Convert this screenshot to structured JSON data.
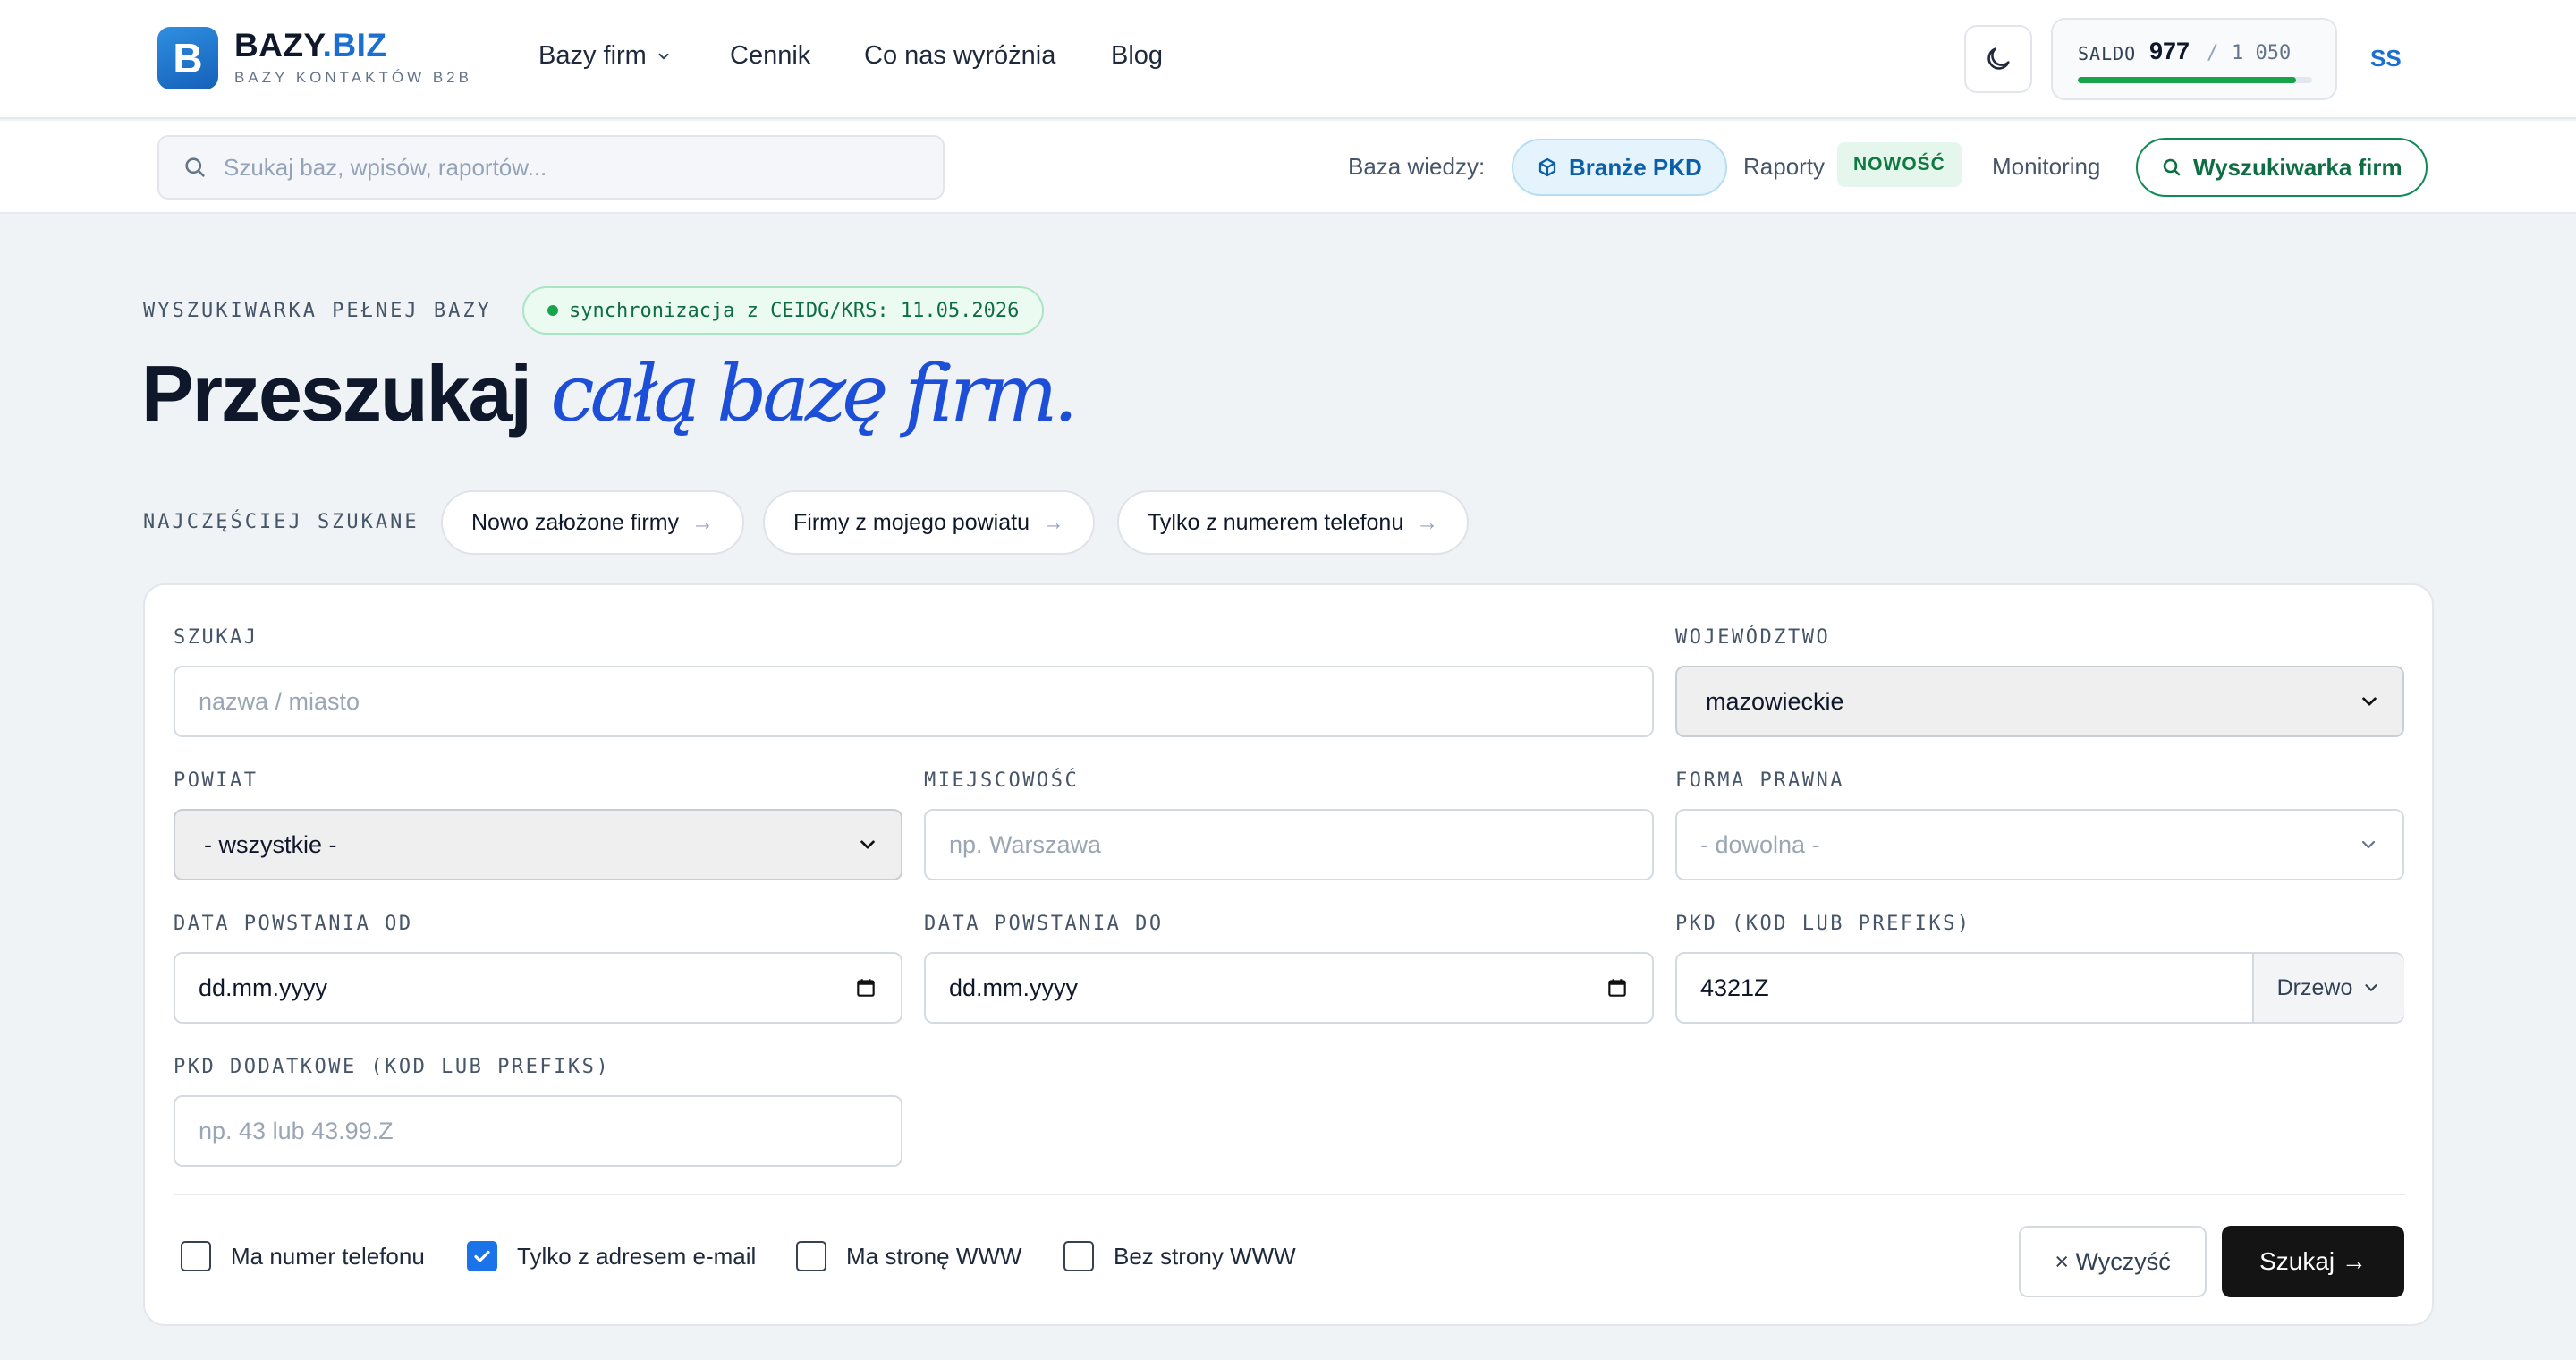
{
  "brand": {
    "logo_letter": "B",
    "name_main": "BAZY",
    "name_accent": ".BIZ",
    "tagline": "BAZY KONTAKTÓW B2B"
  },
  "nav": {
    "bazy_firm": "Bazy firm",
    "cennik": "Cennik",
    "wyroznia": "Co nas wyróżnia",
    "blog": "Blog"
  },
  "saldo": {
    "label": "SALDO",
    "value": "977",
    "separator": "/",
    "max": "1 050",
    "fraction": 0.93
  },
  "user_initials": "SS",
  "subbar": {
    "search_placeholder": "Szukaj baz, wpisów, raportów...",
    "kb_label": "Baza wiedzy:",
    "branze": "Branże PKD",
    "raporty": "Raporty",
    "new_badge": "NOWOŚĆ",
    "monitoring": "Monitoring",
    "wyszukiwarka": "Wyszukiwarka firm"
  },
  "hero": {
    "eyebrow": "WYSZUKIWARKA PEŁNEJ BAZY",
    "sync": "synchronizacja z CEIDG/KRS: 11.05.2026",
    "title_main": "Przeszukaj ",
    "title_accent": "całą bazę firm."
  },
  "frequent": {
    "label": "NAJCZĘŚCIEJ SZUKANE",
    "chips": [
      "Nowo założone firmy",
      "Firmy z mojego powiatu",
      "Tylko z numerem telefonu"
    ],
    "arrow": "→"
  },
  "form": {
    "szukaj": {
      "label": "SZUKAJ",
      "placeholder": "nazwa / miasto"
    },
    "wojewodztwo": {
      "label": "WOJEWÓDZTWO",
      "value": "mazowieckie"
    },
    "powiat": {
      "label": "POWIAT",
      "value": "- wszystkie -"
    },
    "miejscowosc": {
      "label": "MIEJSCOWOŚĆ",
      "placeholder": "np. Warszawa"
    },
    "forma": {
      "label": "FORMA PRAWNA",
      "placeholder": "- dowolna -"
    },
    "data_od": {
      "label": "DATA POWSTANIA OD",
      "value": "dd.mm.yyyy"
    },
    "data_do": {
      "label": "DATA POWSTANIA DO",
      "value": "dd.mm.yyyy"
    },
    "pkd": {
      "label": "PKD (KOD LUB PREFIKS)",
      "value": "4321Z",
      "tree": "Drzewo"
    },
    "pkd_dod": {
      "label": "PKD DODATKOWE (KOD LUB PREFIKS)",
      "placeholder": "np. 43 lub 43.99.Z"
    },
    "checkboxes": [
      {
        "label": "Ma numer telefonu",
        "checked": false
      },
      {
        "label": "Tylko z adresem e-mail",
        "checked": true
      },
      {
        "label": "Ma stronę WWW",
        "checked": false
      },
      {
        "label": "Bez strony WWW",
        "checked": false
      }
    ],
    "clear": "× Wyczyść",
    "search": "Szukaj →"
  },
  "colors": {
    "accent": "#1a6fcf",
    "headline_accent": "#1d4ed8",
    "green": "#16a34a",
    "dark_button": "#141414"
  }
}
